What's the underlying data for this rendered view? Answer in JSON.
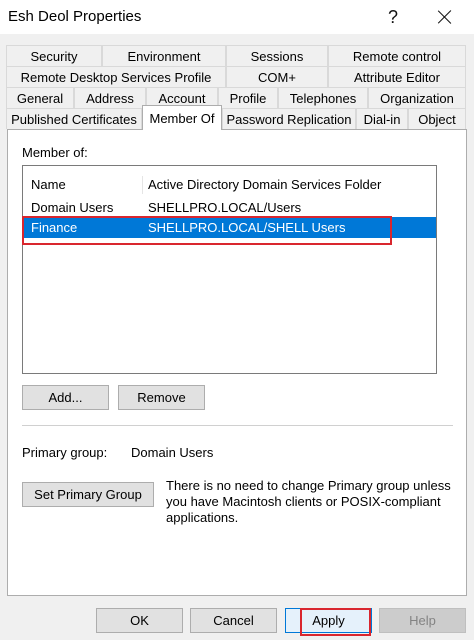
{
  "window": {
    "title": "Esh Deol Properties",
    "help_glyph": "?"
  },
  "tabs": {
    "row1": [
      "Security",
      "Environment",
      "Sessions",
      "Remote control"
    ],
    "row2": [
      "Remote Desktop Services Profile",
      "COM+",
      "Attribute Editor"
    ],
    "row3": [
      "General",
      "Address",
      "Account",
      "Profile",
      "Telephones",
      "Organization"
    ],
    "row4": [
      "Published Certificates",
      "Member Of",
      "Password Replication",
      "Dial-in",
      "Object"
    ],
    "active": "Member Of"
  },
  "member_of": {
    "label": "Member of:",
    "columns": [
      "Name",
      "Active Directory Domain Services Folder"
    ],
    "rows": [
      {
        "name": "Domain Users",
        "folder": "SHELLPRO.LOCAL/Users",
        "selected": false
      },
      {
        "name": "Finance",
        "folder": "SHELLPRO.LOCAL/SHELL Users",
        "selected": true
      }
    ]
  },
  "buttons": {
    "add": "Add...",
    "remove": "Remove",
    "set_primary": "Set Primary Group"
  },
  "primary_group": {
    "label": "Primary group:",
    "value": "Domain Users",
    "note": "There is no need to change Primary group unless you have Macintosh clients or POSIX-compliant applications."
  },
  "dialog_buttons": {
    "ok": "OK",
    "cancel": "Cancel",
    "apply": "Apply",
    "help": "Help"
  },
  "colors": {
    "selection": "#0078d7",
    "annotation": "#d9262e"
  }
}
